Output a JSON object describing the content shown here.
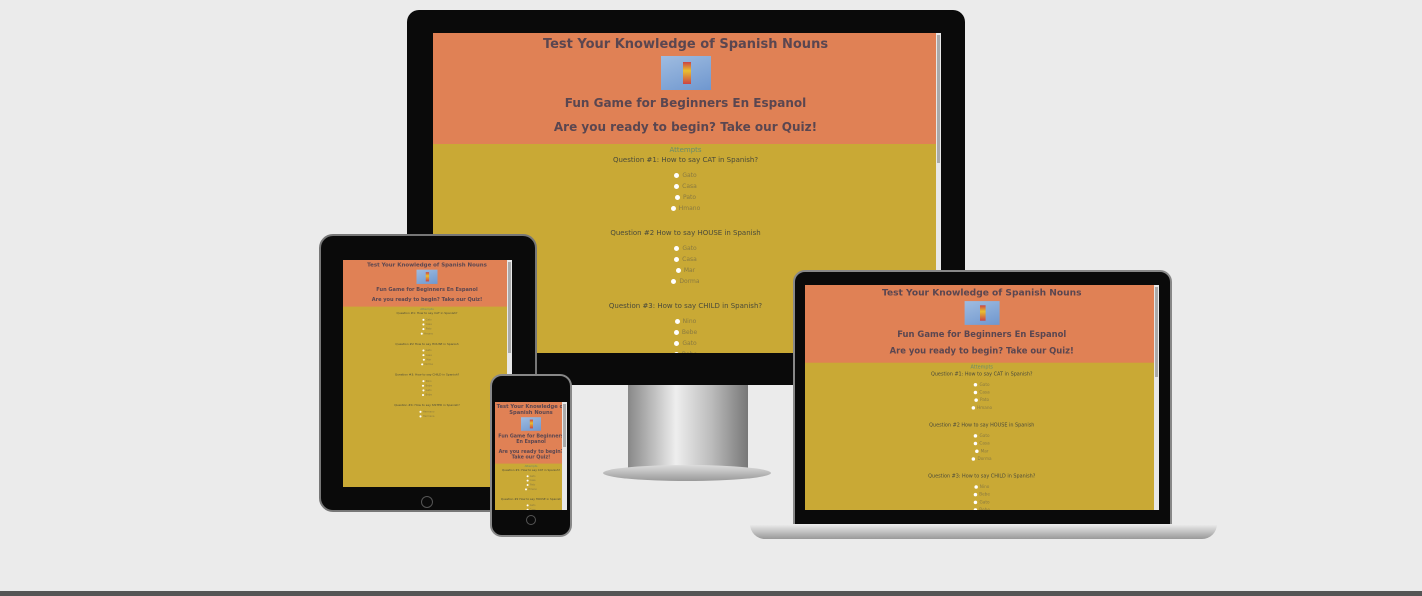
{
  "site": {
    "title": "Test Your Knowledge of Spanish Nouns",
    "subtitle": "Fun Game for Beginners En Espanol",
    "prompt": "Are you ready to begin? Take our Quiz!",
    "attempt_label": "Attempts",
    "questions": [
      {
        "text": "Question #1: How to say CAT in Spanish?",
        "options": [
          "Gato",
          "Casa",
          "Pato",
          "Hmano"
        ]
      },
      {
        "text": "Question #2 How to say HOUSE in Spanish",
        "options": [
          "Gato",
          "Casa",
          "Mar",
          "Dorma"
        ]
      },
      {
        "text": "Question #3: How to say CHILD in Spanish?",
        "options": [
          "Nino",
          "Bebe",
          "Gato",
          "Bebe"
        ]
      },
      {
        "text": "Question #4: How to say SISTER in Spanish?",
        "options": [
          "Hermano",
          "Hermana"
        ]
      }
    ]
  },
  "colors": {
    "header": "#e08155",
    "body": "#c9a935"
  }
}
